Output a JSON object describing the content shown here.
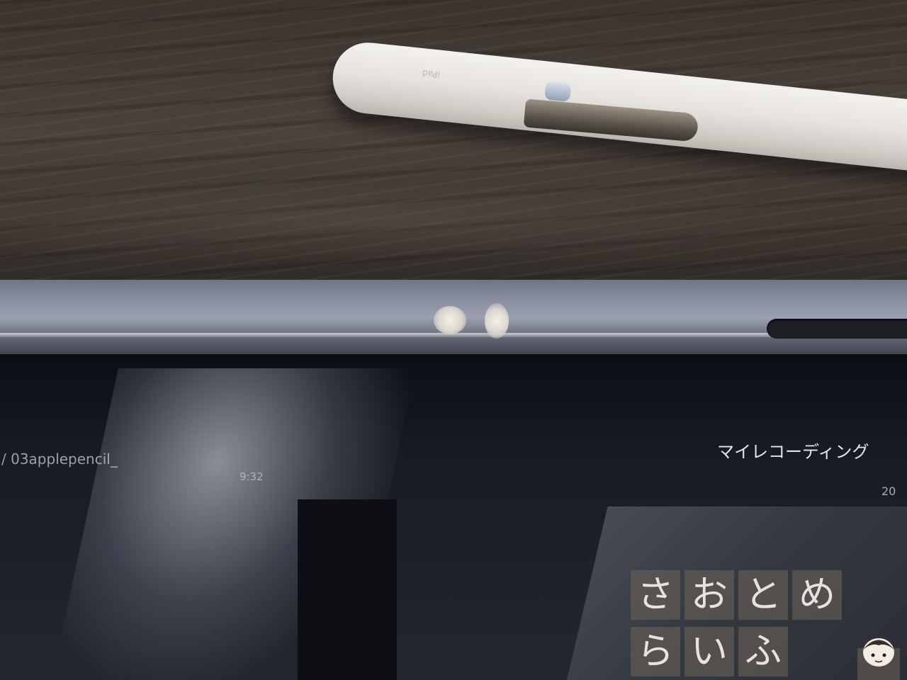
{
  "screen": {
    "file_name": "/ 03applepencil_",
    "duration": "9:32",
    "my_recordings": "マイレコーディング",
    "year_fragment": "20"
  },
  "watermark": {
    "row1": [
      "さ",
      "お",
      "と",
      "め"
    ],
    "row2": [
      "ら",
      "い",
      "ふ"
    ]
  },
  "pencil": {
    "print": "iPad"
  },
  "colors": {
    "desk": "#3b342e",
    "pencil": "#ece9e4",
    "frame": "#8a90a0",
    "screen": "#181b24"
  }
}
